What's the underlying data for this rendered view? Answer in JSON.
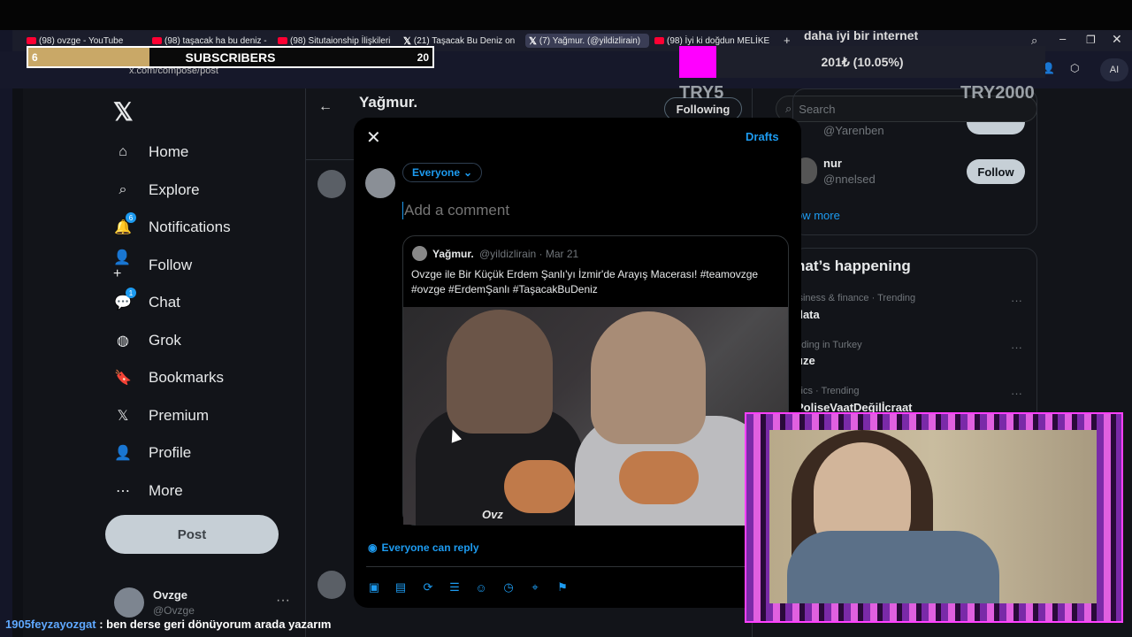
{
  "browser": {
    "tabs": [
      {
        "label": "(98) ovzge - YouTube",
        "icon": "youtube-icon"
      },
      {
        "label": "(98) taşacak ha bu deniz -",
        "icon": "youtube-icon"
      },
      {
        "label": "(98) Situtaionship İlişkileri",
        "icon": "youtube-icon"
      },
      {
        "label": "(21) Taşacak Bu Deniz on",
        "icon": "x-icon"
      },
      {
        "label": "(7) Yağmur. (@yildizlirain)",
        "icon": "x-icon",
        "active": true
      },
      {
        "label": "(98) İyi ki doğdun MELİKE",
        "icon": "youtube-icon"
      }
    ],
    "url": "x.com/compose/post",
    "ai_label": "AI"
  },
  "overlay": {
    "subscribers": {
      "label": "SUBSCRIBERS",
      "current": "6",
      "goal": "20",
      "progress": 0.3
    },
    "donation": {
      "title": "daha iyi bir internet",
      "value": "201₺ (10.05%)",
      "progress": 0.1005,
      "min_label": "TRY5",
      "max_label": "TRY2000"
    }
  },
  "sidebar": {
    "items": [
      {
        "label": "Home",
        "icon": "home-icon"
      },
      {
        "label": "Explore",
        "icon": "search-icon"
      },
      {
        "label": "Notifications",
        "icon": "bell-icon",
        "badge": "6"
      },
      {
        "label": "Follow",
        "icon": "add-person-icon"
      },
      {
        "label": "Chat",
        "icon": "chat-icon",
        "badge": "1"
      },
      {
        "label": "Grok",
        "icon": "grok-icon"
      },
      {
        "label": "Bookmarks",
        "icon": "bookmark-icon"
      },
      {
        "label": "Premium",
        "icon": "x-icon"
      },
      {
        "label": "Profile",
        "icon": "person-icon"
      },
      {
        "label": "More",
        "icon": "more-icon"
      }
    ],
    "post_label": "Post",
    "account": {
      "name": "Ovzge",
      "handle": "@Ovzge"
    }
  },
  "timeline": {
    "title": "Yağmur.",
    "following_label": "Following"
  },
  "right": {
    "search_placeholder": "Search",
    "suggestions": [
      {
        "name": "",
        "handle": "@Yarenben"
      },
      {
        "name": "nur",
        "handle": "@nnelsed",
        "follow_label": "Follow"
      }
    ],
    "show_more": "ow more",
    "whats_happening": "hat’s happening",
    "trends": [
      {
        "meta": "isiness & finance · Trending",
        "name": "data"
      },
      {
        "meta": "nding in Turkey",
        "name": "üze"
      },
      {
        "meta": "itics · Trending",
        "name": "PoliseVaatDeğilİcraat"
      }
    ]
  },
  "compose": {
    "drafts_label": "Drafts",
    "audience_label": "Everyone",
    "placeholder": "Add a comment",
    "quote": {
      "name": "Yağmur.",
      "handle": "@yildizlirain · Mar 21",
      "text": "Ovzge ile Bir Küçük Erdem Şanlı'yı İzmir'de Arayış Macerası! #teamovzge #ovzge #ErdemŞanlı #TaşacakBuDeniz",
      "watermark": "Ovz"
    },
    "reply_setting": "Everyone can reply"
  },
  "chat": {
    "user": "1905feyzayozgat",
    "message": " : ben derse geri dönüyorum arada yazarım"
  },
  "colors": {
    "accent": "#1d9bf0",
    "subs_fill": "#c9a867",
    "donation_fill": "#ff00ff"
  }
}
